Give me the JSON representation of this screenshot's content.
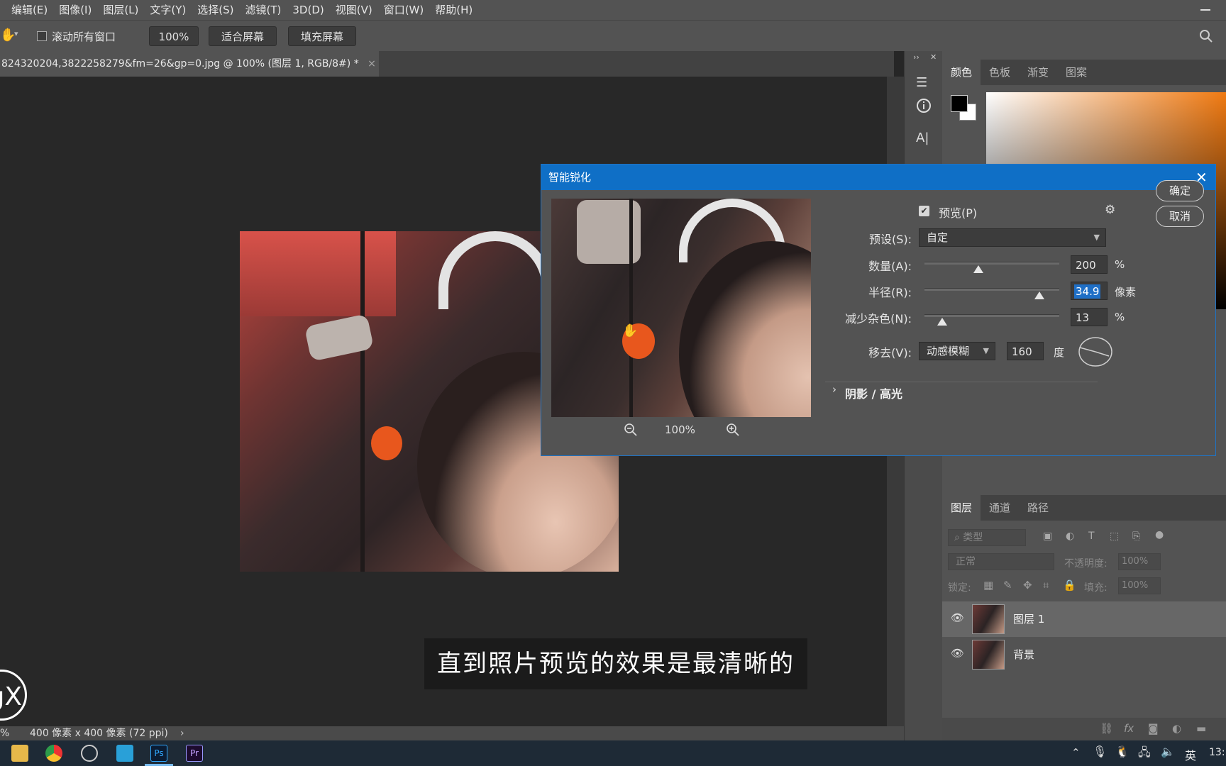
{
  "menubar": {
    "items": [
      "编辑(E)",
      "图像(I)",
      "图层(L)",
      "文字(Y)",
      "选择(S)",
      "滤镜(T)",
      "3D(D)",
      "视图(V)",
      "窗口(W)",
      "帮助(H)"
    ]
  },
  "options": {
    "scroll_all_label": "滚动所有窗口",
    "zoom_value": "100%",
    "fit_screen": "适合屏幕",
    "fill_screen": "填充屏幕"
  },
  "document": {
    "tab_title": "824320204,3822258279&fm=26&gp=0.jpg @ 100% (图层 1, RGB/8#) *",
    "status_text": "400 像素 x 400 像素 (72 ppi)",
    "status_zoom": "%"
  },
  "panels": {
    "color_tabs": [
      "颜色",
      "色板",
      "渐变",
      "图案"
    ],
    "layers_tabs": [
      "图层",
      "通道",
      "路径"
    ],
    "filter_placeholder": "类型",
    "blend_mode": "正常",
    "opacity_label": "不透明度:",
    "opacity_value": "100%",
    "lock_label": "锁定:",
    "fill_label": "填充:",
    "fill_value": "100%",
    "layers": [
      {
        "name": "图层 1"
      },
      {
        "name": "背景"
      }
    ]
  },
  "dialog": {
    "title": "智能锐化",
    "preview_label": "预览(P)",
    "preview_checked": true,
    "ok_label": "确定",
    "cancel_label": "取消",
    "preset_label": "预设(S):",
    "preset_value": "自定",
    "amount_label": "数量(A):",
    "amount_value": "200",
    "amount_unit": "%",
    "amount_fraction": 0.4,
    "radius_label": "半径(R):",
    "radius_value": "34.9",
    "radius_unit": "像素",
    "radius_fraction": 0.85,
    "noise_label": "减少杂色(N):",
    "noise_value": "13",
    "noise_unit": "%",
    "noise_fraction": 0.13,
    "remove_label": "移去(V):",
    "remove_value": "动感模糊",
    "angle_value": "160",
    "angle_unit": "度",
    "shadows_label": "阴影 / 高光",
    "zoom_value": "100%"
  },
  "subtitle": "直到照片预览的效果是最清晰的",
  "taskbar": {
    "ime": "英",
    "clock": "13:"
  }
}
